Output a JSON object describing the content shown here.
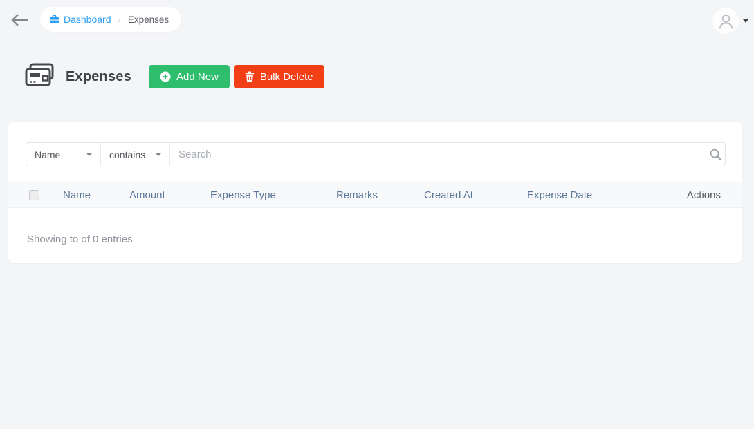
{
  "breadcrumb": {
    "dashboard_label": "Dashboard",
    "separator": "›",
    "current_label": "Expenses"
  },
  "user_menu": {
    "avatar_icon": "person-icon",
    "caret_icon": "chevron-down-icon"
  },
  "page_header": {
    "title": "Expenses",
    "title_icon": "expense-cards-icon",
    "add_new_label": "Add New",
    "bulk_delete_label": "Bulk Delete"
  },
  "filter": {
    "field_selected": "Name",
    "operator_selected": "contains",
    "search_placeholder": "Search"
  },
  "table": {
    "columns": [
      "Name",
      "Amount",
      "Expense Type",
      "Remarks",
      "Created At",
      "Expense Date",
      "Actions"
    ],
    "rows": [],
    "summary": "Showing to of 0 entries"
  },
  "icons": {
    "back": "arrow-left-icon",
    "breadcrumb": "briefcase-icon",
    "add_new": "plus-circle-icon",
    "bulk_delete": "trash-icon",
    "search": "magnifier-icon"
  },
  "colors": {
    "accent_blue": "#2e9ff5",
    "button_green": "#2fbe6e",
    "button_red": "#f23f16",
    "column_link": "#5a7699",
    "page_background": "#f4f5f7",
    "card_background": "#ffffff"
  }
}
